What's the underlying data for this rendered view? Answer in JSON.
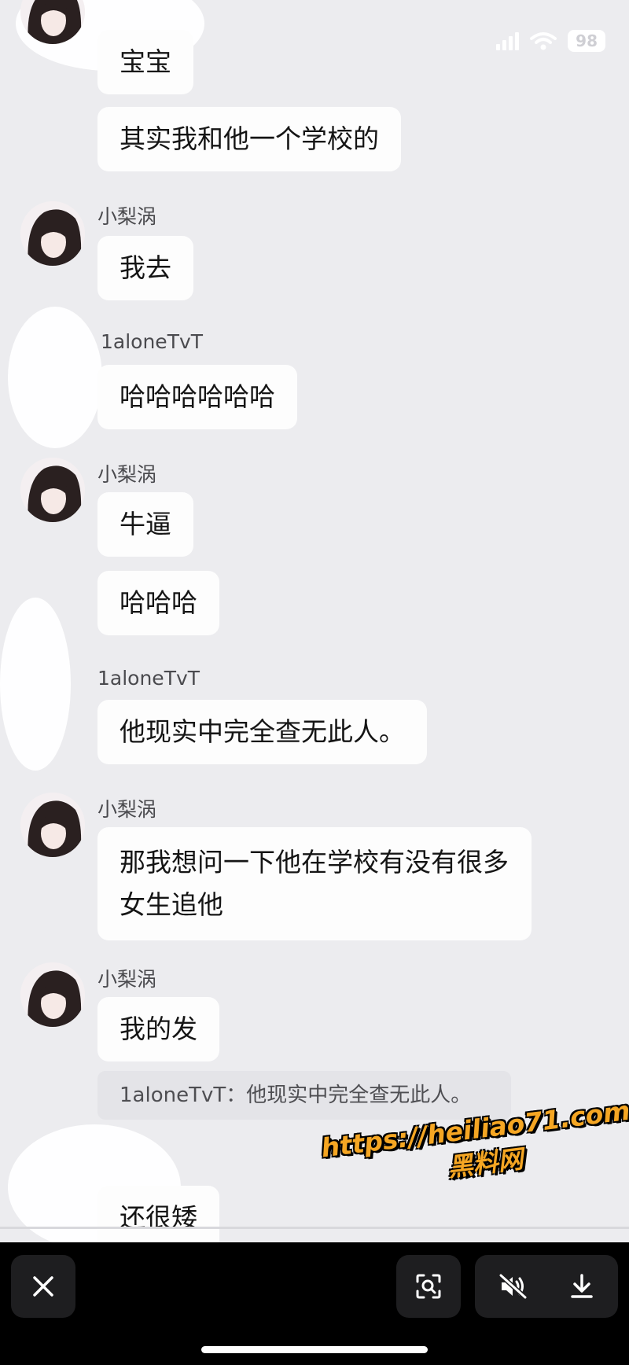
{
  "status_bar": {
    "battery": "98"
  },
  "messages": [
    {
      "sender": "",
      "text": "宝宝"
    },
    {
      "sender": "",
      "text": "其实我和他一个学校的"
    },
    {
      "sender": "小梨涡",
      "text": "我去"
    },
    {
      "sender": "1aloneTvT",
      "text": "哈哈哈哈哈哈"
    },
    {
      "sender": "小梨涡",
      "text": "牛逼"
    },
    {
      "sender": "",
      "text": "哈哈哈"
    },
    {
      "sender": "1aloneTvT",
      "text": "他现实中完全查无此人。"
    },
    {
      "sender": "小梨涡",
      "text": "那我想问一下他在学校有没有很多女生追他"
    },
    {
      "sender": "小梨涡",
      "text": "我的发"
    },
    {
      "sender": "",
      "text": "还很矮"
    }
  ],
  "quote": {
    "text": "1aloneTvT：他现实中完全查无此人。"
  },
  "watermark": {
    "url": "https://heiliao71.com",
    "name": "黑料网"
  },
  "toolbar": {
    "close_icon": "close-icon",
    "scan_icon": "scan-icon",
    "mute_icon": "speaker-muted-icon",
    "download_icon": "download-icon"
  }
}
